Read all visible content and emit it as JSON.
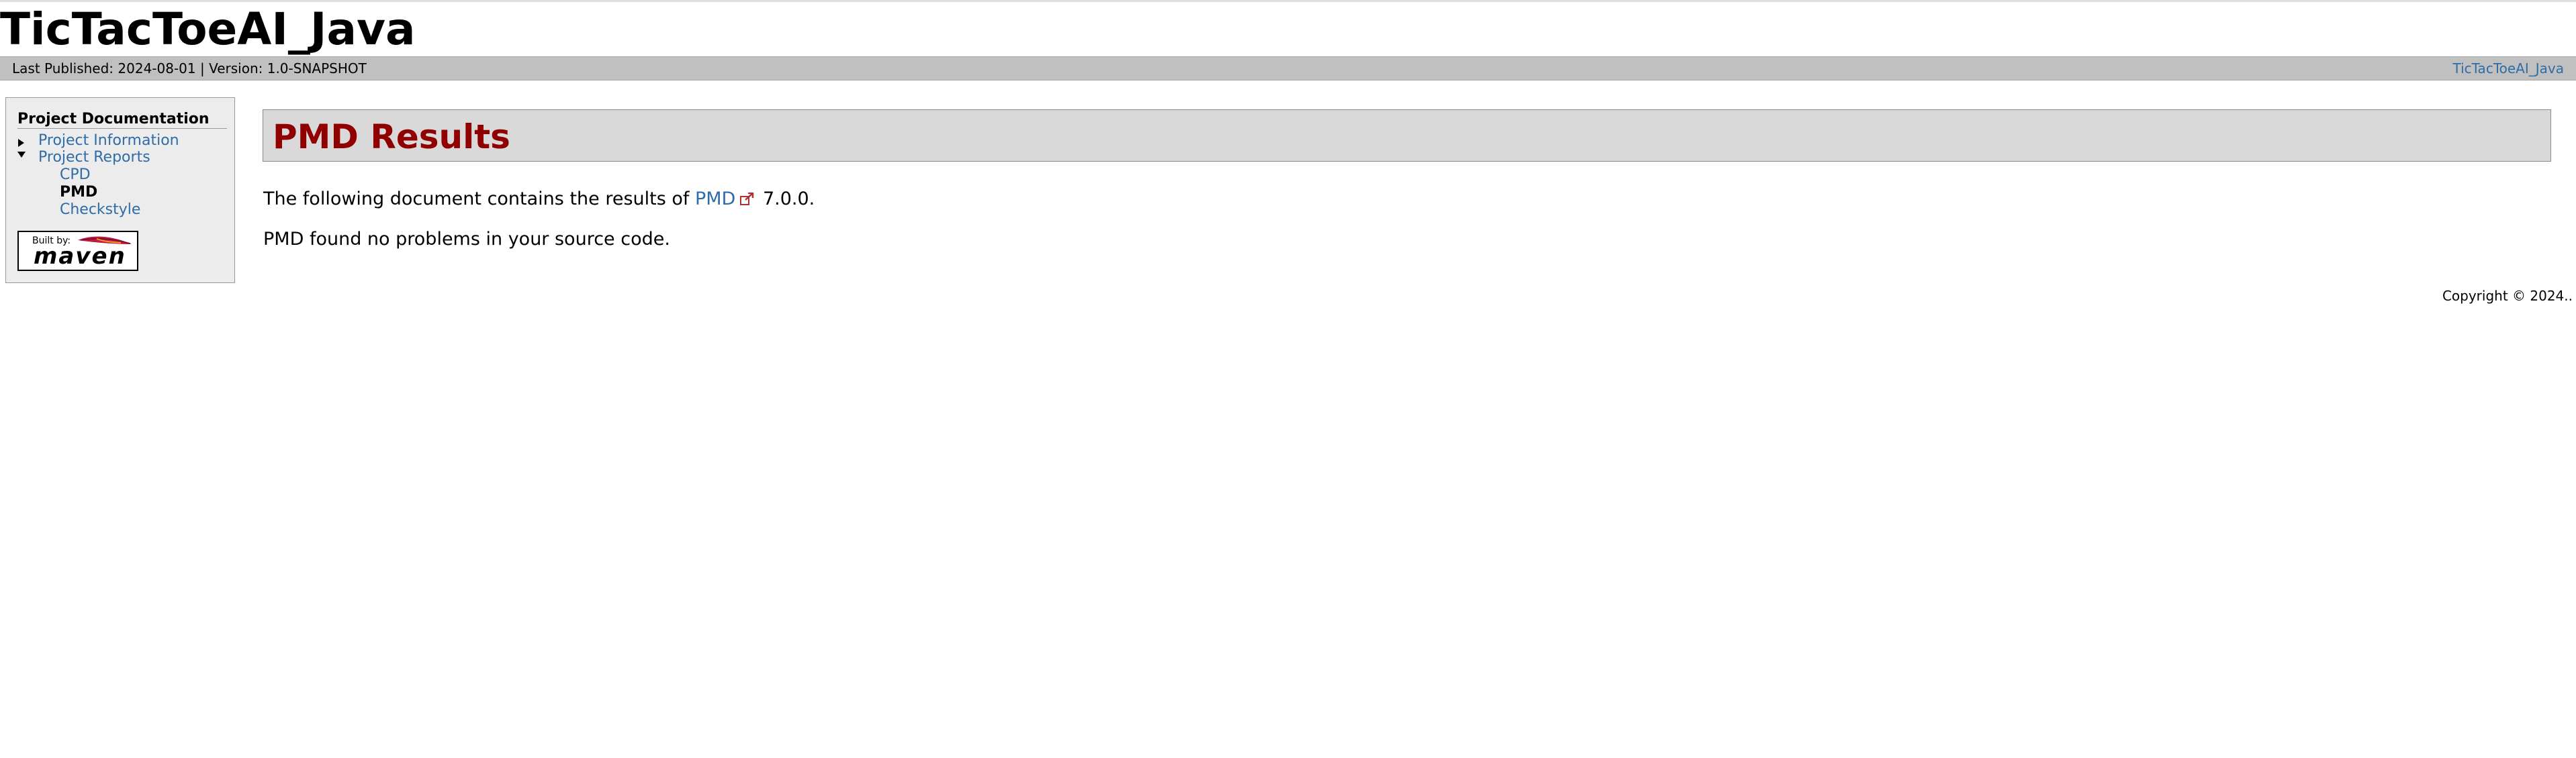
{
  "banner": {
    "title": "TicTacToeAI_Java"
  },
  "breadcrumbs": {
    "published": "Last Published: 2024-08-01 | Version: 1.0-SNAPSHOT",
    "project_link": "TicTacToeAI_Java"
  },
  "navigation": {
    "heading": "Project Documentation",
    "items": [
      {
        "label": "Project Information",
        "state": "collapsed"
      },
      {
        "label": "Project Reports",
        "state": "expanded"
      }
    ],
    "sub_items": [
      {
        "label": "CPD",
        "current": false
      },
      {
        "label": "PMD",
        "current": true
      },
      {
        "label": "Checkstyle",
        "current": false
      }
    ]
  },
  "powered_by": {
    "built_by": "Built by:",
    "maven": "maven"
  },
  "main": {
    "heading": "PMD Results",
    "intro_before": "The following document contains the results of ",
    "intro_link": "PMD",
    "intro_after": " 7.0.0.",
    "status": "PMD found no problems in your source code."
  },
  "footer": {
    "copyright": "Copyright © 2024.."
  },
  "icons": {
    "collapsed_arrow": "triangle-right-icon",
    "expanded_arrow": "triangle-down-icon",
    "external_link": "external-link-icon"
  },
  "colors": {
    "link": "#2e6ca8",
    "heading": "#900000",
    "breadcrumb_bar": "#c0c0c0",
    "nav_background": "#ececec",
    "heading_box": "#d9d9d9"
  }
}
